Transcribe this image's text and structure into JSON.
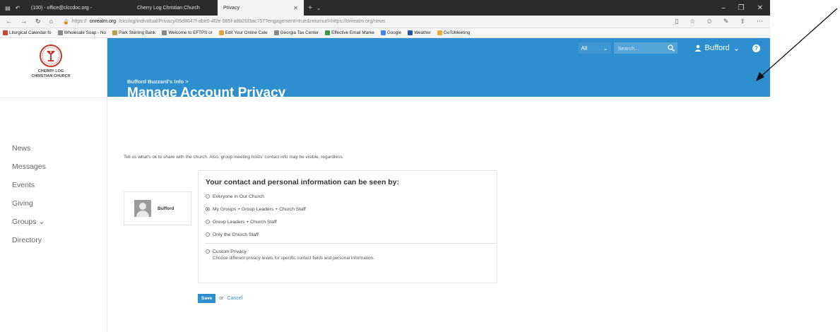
{
  "browser": {
    "tabs": [
      {
        "label": "(100) - office@clccdoc.org -"
      },
      {
        "label": "Cherry Log Christian Church"
      },
      {
        "label": "Privacy"
      }
    ],
    "url_host": "onrealm.org",
    "url_prefix": "https://",
    "url_rest": "/cicclog/individual/Privacy/05d8647f-abe0-4f2e-985f-a8b26f3ac757?engagement=true&returnurl=https://onrealm.org/news",
    "favorites": [
      {
        "label": "Liturgical Calendar fo",
        "color": "#c74634"
      },
      {
        "label": "Wholesale Soap - No",
        "color": "#888888"
      },
      {
        "label": "Park Sterling Bank",
        "color": "#b9a04a"
      },
      {
        "label": "Welcome to EFTPS or",
        "color": "#888888"
      },
      {
        "label": "Edit Your Online Cale",
        "color": "#e2a33b"
      },
      {
        "label": "Georgia Tax Center",
        "color": "#888888"
      },
      {
        "label": "Effective Email Marke",
        "color": "#3b9b44"
      },
      {
        "label": "Google",
        "color": "#4285f4"
      },
      {
        "label": "Weather",
        "color": "#1e5aa8"
      },
      {
        "label": "GoToMeeting",
        "color": "#f2a93b"
      }
    ]
  },
  "sidebar": {
    "logo_text_line1": "CHERRY LOG",
    "logo_text_line2": "CHRISTIAN CHURCH",
    "items": [
      {
        "label": "News"
      },
      {
        "label": "Messages"
      },
      {
        "label": "Events"
      },
      {
        "label": "Giving"
      },
      {
        "label": "Groups  ⌄"
      },
      {
        "label": "Directory"
      }
    ]
  },
  "header": {
    "breadcrumb": "Bufford Buzzard's Info >",
    "title": "Manage Account Privacy",
    "scope_value": "All",
    "search_placeholder": "Search...",
    "user_name": "Bufford",
    "accent_color": "#2e8fcf"
  },
  "main": {
    "intro_text": "Tell us what's ok to share with the church. Also, group meeting hosts' contact info may be visible, regardless.",
    "card_name": "Bufford",
    "box_title": "Your contact and personal information can be seen by:",
    "options": [
      {
        "label": "Everyone in Our Church",
        "selected": false
      },
      {
        "label": "My Groups + Group Leaders + Church Staff",
        "selected": true
      },
      {
        "label": "Group Leaders + Church Staff",
        "selected": false
      },
      {
        "label": "Only the Church Staff",
        "selected": false
      }
    ],
    "custom_label": "Custom Privacy",
    "custom_desc": "Choose different privacy levels for specific contact fields and personal information.",
    "save_label": "Save",
    "or_text": "or",
    "cancel_label": "Cancel"
  }
}
